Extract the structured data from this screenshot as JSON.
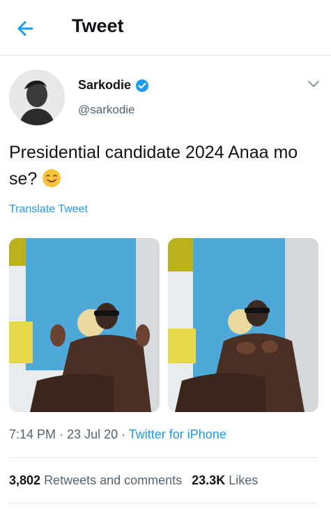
{
  "header": {
    "title": "Tweet",
    "back_icon": "arrow-left-icon"
  },
  "author": {
    "name": "Sarkodie",
    "handle": "@sarkodie",
    "verified_icon": "verified-badge-icon",
    "more_icon": "chevron-down-icon"
  },
  "tweet": {
    "text": "Presidential candidate 2024 Anaa mo se?",
    "emoji_icon": "smiling-face-emoji-icon",
    "translate_label": "Translate Tweet",
    "photos": [
      {
        "alt_icon": "photo-icon"
      },
      {
        "alt_icon": "photo-icon"
      }
    ]
  },
  "meta": {
    "time": "7:14 PM",
    "separator": " · ",
    "date": "23 Jul 20",
    "source": "Twitter for iPhone"
  },
  "stats": {
    "retweets_count": "3,802",
    "retweets_label": "Retweets and comments",
    "likes_count": "23.3K",
    "likes_label": "Likes"
  },
  "colors": {
    "accent": "#1d9bf0",
    "text_primary": "#0f1419",
    "text_secondary": "#536471",
    "divider": "#e3e6e8"
  }
}
